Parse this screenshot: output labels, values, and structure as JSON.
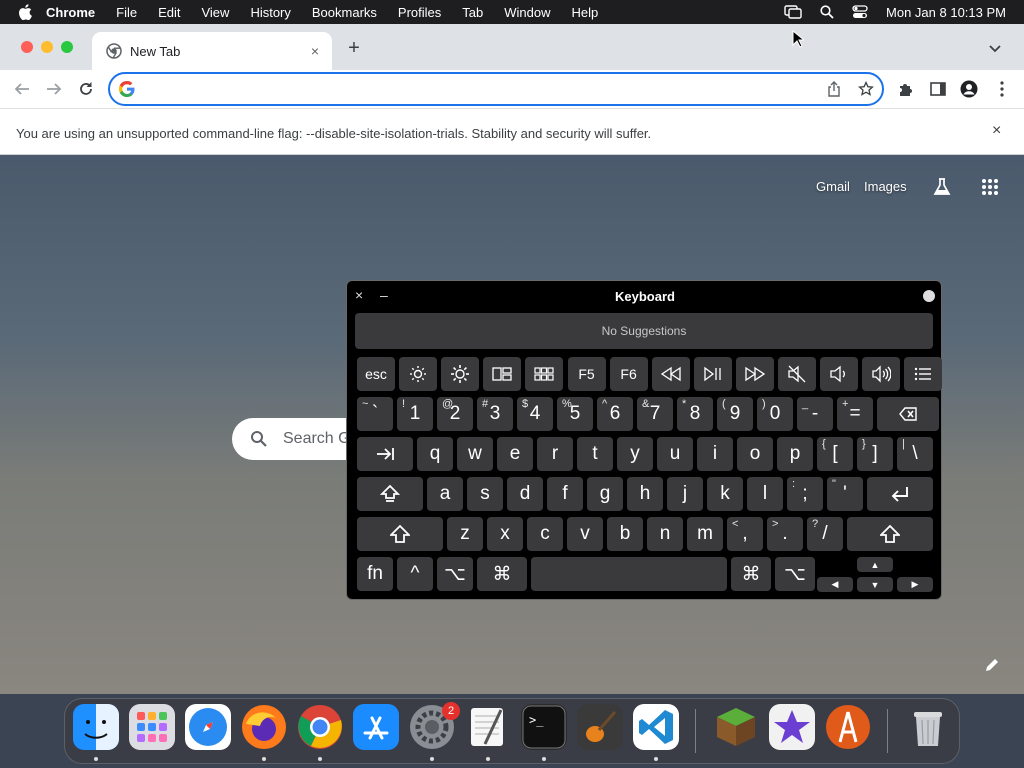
{
  "menubar": {
    "app_name": "Chrome",
    "items": [
      "File",
      "Edit",
      "View",
      "History",
      "Bookmarks",
      "Profiles",
      "Tab",
      "Window",
      "Help"
    ],
    "clock": "Mon Jan 8  10:13 PM"
  },
  "tab": {
    "title": "New Tab",
    "close": "×",
    "new_tab": "+"
  },
  "omnibox": {
    "value": ""
  },
  "infobar": {
    "message": "You are using an unsupported command-line flag: --disable-site-isolation-trials. Stability and security will suffer.",
    "close": "×"
  },
  "new_tab_page": {
    "links": [
      "Gmail",
      "Images"
    ],
    "search_placeholder": "Search Google or type a URL",
    "search_visible_text": "Search G"
  },
  "keyboard_viewer": {
    "title": "Keyboard",
    "close": "×",
    "minimize": "–",
    "suggestions": "No Suggestions",
    "rows": {
      "fn_row": [
        "esc",
        "brightness-down-icon",
        "brightness-up-icon",
        "mission-control-icon",
        "launchpad-icon",
        "F5",
        "F6",
        "rewind-icon",
        "play-pause-icon",
        "fast-forward-icon",
        "mute-icon",
        "volume-down-icon",
        "volume-up-icon",
        "list-icon"
      ],
      "number_row": [
        {
          "main": "`",
          "shift": "~"
        },
        {
          "main": "1",
          "shift": "!"
        },
        {
          "main": "2",
          "shift": "@"
        },
        {
          "main": "3",
          "shift": "#"
        },
        {
          "main": "4",
          "shift": "$"
        },
        {
          "main": "5",
          "shift": "%"
        },
        {
          "main": "6",
          "shift": "^"
        },
        {
          "main": "7",
          "shift": "&"
        },
        {
          "main": "8",
          "shift": "*"
        },
        {
          "main": "9",
          "shift": "("
        },
        {
          "main": "0",
          "shift": ")"
        },
        {
          "main": "-",
          "shift": "_"
        },
        {
          "main": "=",
          "shift": "+"
        },
        {
          "main": "delete-icon",
          "shift": ""
        }
      ],
      "qwerty_row": [
        {
          "main": "tab-icon",
          "shift": ""
        },
        {
          "main": "q",
          "shift": ""
        },
        {
          "main": "w",
          "shift": ""
        },
        {
          "main": "e",
          "shift": ""
        },
        {
          "main": "r",
          "shift": ""
        },
        {
          "main": "t",
          "shift": ""
        },
        {
          "main": "y",
          "shift": ""
        },
        {
          "main": "u",
          "shift": ""
        },
        {
          "main": "i",
          "shift": ""
        },
        {
          "main": "o",
          "shift": ""
        },
        {
          "main": "p",
          "shift": ""
        },
        {
          "main": "[",
          "shift": "{"
        },
        {
          "main": "]",
          "shift": "}"
        },
        {
          "main": "\\",
          "shift": "|"
        }
      ],
      "home_row": [
        {
          "main": "caps-lock-icon",
          "shift": ""
        },
        {
          "main": "a",
          "shift": ""
        },
        {
          "main": "s",
          "shift": ""
        },
        {
          "main": "d",
          "shift": ""
        },
        {
          "main": "f",
          "shift": ""
        },
        {
          "main": "g",
          "shift": ""
        },
        {
          "main": "h",
          "shift": ""
        },
        {
          "main": "j",
          "shift": ""
        },
        {
          "main": "k",
          "shift": ""
        },
        {
          "main": "l",
          "shift": ""
        },
        {
          "main": ";",
          "shift": ":"
        },
        {
          "main": "'",
          "shift": "\""
        },
        {
          "main": "return-icon",
          "shift": ""
        }
      ],
      "shift_row": [
        {
          "main": "shift-icon",
          "shift": ""
        },
        {
          "main": "z",
          "shift": ""
        },
        {
          "main": "x",
          "shift": ""
        },
        {
          "main": "c",
          "shift": ""
        },
        {
          "main": "v",
          "shift": ""
        },
        {
          "main": "b",
          "shift": ""
        },
        {
          "main": "n",
          "shift": ""
        },
        {
          "main": "m",
          "shift": ""
        },
        {
          "main": ",",
          "shift": "<"
        },
        {
          "main": ".",
          "shift": ">"
        },
        {
          "main": "/",
          "shift": "?"
        },
        {
          "main": "shift-icon",
          "shift": ""
        }
      ],
      "bottom_row": [
        "fn",
        "^",
        "⌥",
        "⌘",
        "",
        "⌘",
        "⌥"
      ],
      "arrows": [
        "▲",
        "◀",
        "▼",
        "▶"
      ]
    }
  },
  "dock": {
    "apps": [
      "Finder",
      "Launchpad",
      "Safari",
      "Firefox",
      "Google Chrome",
      "App Store",
      "System Settings",
      "TextEdit",
      "Terminal",
      "GarageBand",
      "Visual Studio Code",
      "Minecraft",
      "iMovie",
      "Anaconda",
      "Trash"
    ],
    "settings_badge": "2",
    "terminal_label": ">_"
  },
  "colors": {
    "accent": "#1a73e8",
    "menubar": "#1e1e20",
    "tabstrip": "#dee1e6",
    "key": "#3a3a3c"
  }
}
